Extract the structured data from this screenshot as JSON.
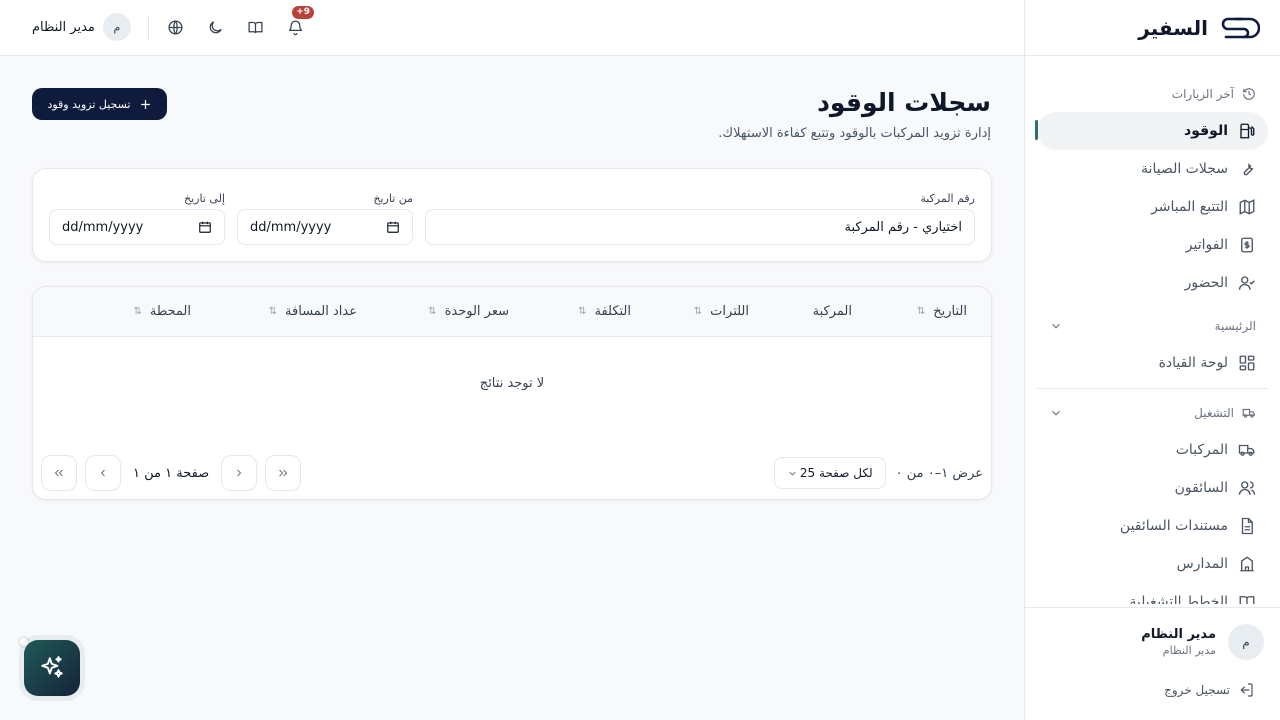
{
  "app": {
    "name": "السفير"
  },
  "sidebar": {
    "recent": {
      "title": "آخر الزيارات"
    },
    "recent_items": [
      {
        "label": "الوقود",
        "icon": "fuel-icon",
        "active": true
      },
      {
        "label": "سجلات الصيانة",
        "icon": "wrench-icon"
      },
      {
        "label": "التتبع المباشر",
        "icon": "map-icon"
      },
      {
        "label": "الفواتير",
        "icon": "invoice-icon"
      },
      {
        "label": "الحضور",
        "icon": "user-check-icon"
      }
    ],
    "main": {
      "title": "الرئيسية"
    },
    "main_items": [
      {
        "label": "لوحة القيادة",
        "icon": "dashboard-icon"
      }
    ],
    "operations": {
      "title": "التشغيل"
    },
    "operations_items": [
      {
        "label": "المركبات",
        "icon": "truck-icon"
      },
      {
        "label": "السائقون",
        "icon": "users-icon"
      },
      {
        "label": "مستندات السائقين",
        "icon": "document-icon"
      },
      {
        "label": "المدارس",
        "icon": "school-icon"
      },
      {
        "label": "الخطط التشغيلية",
        "icon": "book-icon"
      }
    ],
    "user": {
      "initial": "م",
      "name": "مدير النظام",
      "role": "مدير النظام"
    },
    "logout_label": "تسجيل خروج"
  },
  "topbar": {
    "user_name": "مدير النظام",
    "user_initial": "م",
    "notifications_badge": "+9"
  },
  "page": {
    "title": "سجلات الوقود",
    "subtitle": "إدارة تزويد المركبات بالوقود وتتبع كفاءة الاستهلاك.",
    "add_button": "تسجيل تزويد وقود"
  },
  "filters": {
    "vehicle_label": "رقم المركبة",
    "vehicle_placeholder": "اختياري - رقم المركبة",
    "from_label": "من تاريخ",
    "to_label": "إلى تاريخ",
    "date_placeholder": "dd/mm/yyyy"
  },
  "table": {
    "columns": [
      "التاريخ",
      "المركبة",
      "اللترات",
      "التكلفة",
      "سعر الوحدة",
      "عداد المسافة",
      "المحطة"
    ],
    "empty_text": "لا توجد نتائج",
    "rows_info": "عرض ١–٠ من ٠",
    "per_page": "لكل صفحة 25",
    "page_info": "صفحة ١ من ١"
  },
  "colors": {
    "accent": "#2f6f6a",
    "primary_button": "#0f1b3d",
    "badge": "#b8423a"
  }
}
